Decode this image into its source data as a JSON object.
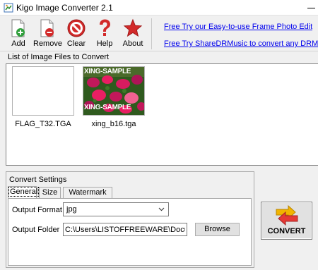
{
  "window": {
    "title": "Kigo Image Converter 2.1"
  },
  "toolbar": {
    "add_label": "Add",
    "remove_label": "Remove",
    "clear_label": "Clear",
    "help_label": "Help",
    "about_label": "About",
    "icons": [
      "add-file-icon",
      "remove-file-icon",
      "clear-icon",
      "help-icon",
      "about-star-icon"
    ]
  },
  "promo_links": [
    "Free Try our Easy-to-use Frame Photo Editor",
    "Free Try ShareDRMusic to convert any DRM music to"
  ],
  "file_list": {
    "legend": "List of Image Files to Convert",
    "items": [
      {
        "name": "FLAG_T32.TGA",
        "watermark": ""
      },
      {
        "name": "xing_b16.tga",
        "watermark": "XING-SAMPLE"
      }
    ]
  },
  "settings": {
    "legend": "Convert Settings",
    "tabs": [
      "General",
      "Size",
      "Watermark"
    ],
    "active_tab": "General",
    "output_format_label": "Output Format",
    "output_format_value": "jpg",
    "output_folder_label": "Output Folder",
    "output_folder_value": "C:\\Users\\LISTOFFREEWARE\\Documents",
    "browse_label": "Browse"
  },
  "convert": {
    "label": "CONVERT"
  },
  "colors": {
    "link": "#0000ee",
    "accent_red": "#d22a2a",
    "window_bg": "#f0f0f0"
  }
}
